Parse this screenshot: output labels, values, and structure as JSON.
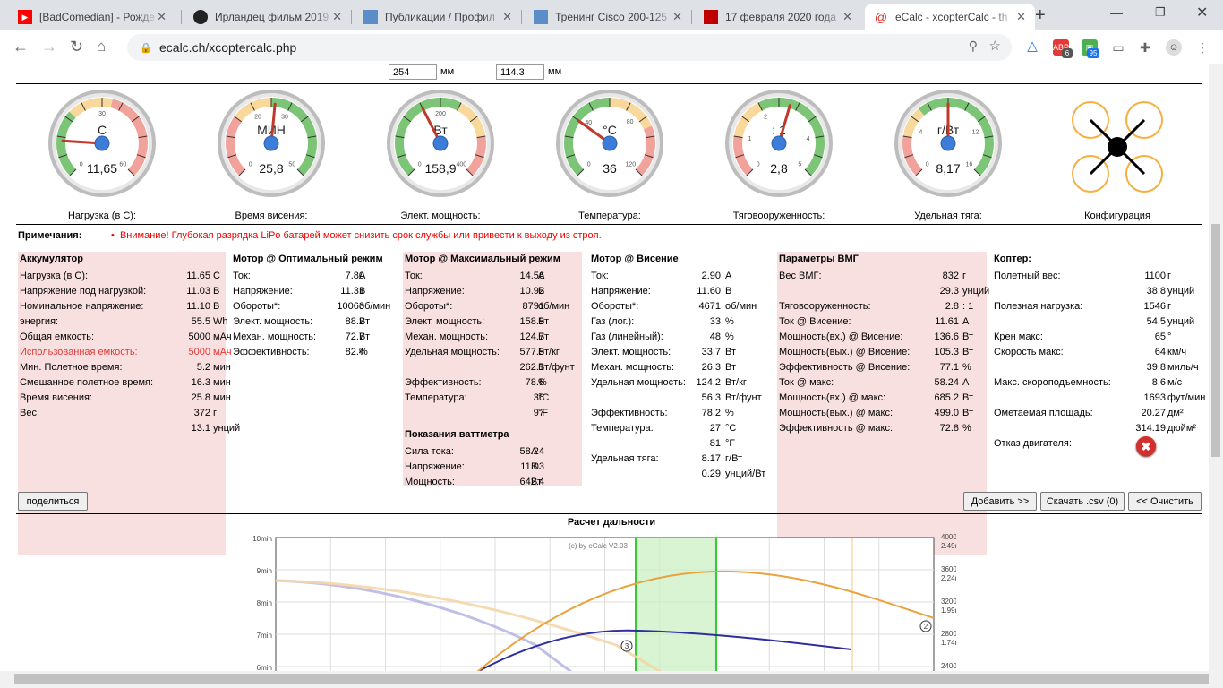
{
  "browser": {
    "tabs": [
      {
        "title": "[BadComedian] - Рожде",
        "icon": "youtube-icon",
        "color": "#ff0000"
      },
      {
        "title": "Ирландец фильм 2019",
        "icon": "avatar-icon",
        "color": "#222222"
      },
      {
        "title": "Публикации / Профил",
        "icon": "site-icon",
        "color": "#5b8ec9"
      },
      {
        "title": "Тренинг Cisco 200-125",
        "icon": "site-icon",
        "color": "#5b8ec9"
      },
      {
        "title": "17 февраля 2020 года",
        "icon": "news-icon",
        "color": "#c00000"
      },
      {
        "title": "eCalc - xcopterCalc - th",
        "icon": "ecalc-icon",
        "color": "#d0312d"
      }
    ],
    "url": "ecalc.ch/xcoptercalc.php",
    "ext_badges": [
      "6",
      "95"
    ]
  },
  "dims": {
    "v1": "254",
    "v2": "114.3",
    "unit": "мм"
  },
  "gauges": [
    {
      "unit": "C",
      "value": "11,65",
      "label": "Нагрузка (в С):",
      "ticks": [
        "0",
        "30",
        "60"
      ]
    },
    {
      "unit": "МИН",
      "value": "25,8",
      "label": "Время висения:",
      "ticks": [
        "0",
        "20",
        "30",
        "50"
      ]
    },
    {
      "unit": "Вт",
      "value": "158,9",
      "label": "Элект. мощность:",
      "ticks": [
        "0",
        "200",
        "400"
      ]
    },
    {
      "unit": "°C",
      "value": "36",
      "label": "Температура:",
      "ticks": [
        "0",
        "40",
        "80",
        "120"
      ]
    },
    {
      "unit": ": 1",
      "value": "2,8",
      "label": "Тяговооруженность:",
      "ticks": [
        "0",
        "1",
        "2",
        "4",
        "5"
      ]
    },
    {
      "unit": "г/Вт",
      "value": "8,17",
      "label": "Удельная тяга:",
      "ticks": [
        "0",
        "4",
        "12",
        "16"
      ]
    }
  ],
  "config_label": "Конфигурация",
  "notes": {
    "label": "Примечания:",
    "warning": "Внимание! Глубокая разрядка LiPo батарей может снизить срок службы или привести к выходу из строя."
  },
  "panels": {
    "battery": {
      "title": "Аккумулятор",
      "rows": [
        [
          "Нагрузка (в С):",
          "11.65",
          "C"
        ],
        [
          "Напряжение под нагрузкой:",
          "11.03",
          "В"
        ],
        [
          "Номинальное напряжение:",
          "11.10",
          "В"
        ],
        [
          "энергия:",
          "55.5",
          "Wh"
        ],
        [
          "Общая емкость:",
          "5000",
          "мАч"
        ],
        [
          "Использованная емкость:",
          "5000",
          "мАч"
        ],
        [
          "Мин. Полетное время:",
          "5.2",
          "мин"
        ],
        [
          "Смешанное полетное время:",
          "16.3",
          "мин"
        ],
        [
          "Время висения:",
          "25.8",
          "мин"
        ],
        [
          "Вес:",
          "372",
          "г"
        ],
        [
          "",
          "13.1",
          "унций"
        ]
      ]
    },
    "motor_opt": {
      "title": "Мотор @ Оптимальный режим",
      "rows": [
        [
          "Ток:",
          "7.80",
          "А"
        ],
        [
          "Напряжение:",
          "11.31",
          "В"
        ],
        [
          "Обороты*:",
          "10063",
          "об/мин"
        ],
        [
          "Элект. мощность:",
          "88.2",
          "Вт"
        ],
        [
          "Механ. мощность:",
          "72.7",
          "Вт"
        ],
        [
          "Эффективность:",
          "82.4",
          "%"
        ]
      ]
    },
    "motor_max": {
      "title": "Мотор @ Максимальный режим",
      "rows": [
        [
          "Ток:",
          "14.56",
          "А"
        ],
        [
          "Напряжение:",
          "10.92",
          "В"
        ],
        [
          "Обороты*:",
          "8791",
          "об/мин"
        ],
        [
          "Элект. мощность:",
          "158.9",
          "Вт"
        ],
        [
          "Механ. мощность:",
          "124.7",
          "Вт"
        ],
        [
          "Удельная мощность:",
          "577.9",
          "Вт/кг"
        ],
        [
          "",
          "262.1",
          "Вт/фунт"
        ],
        [
          "Эффективность:",
          "78.5",
          "%"
        ],
        [
          "Температура:",
          "36",
          "°C"
        ],
        [
          "",
          "97",
          "°F"
        ]
      ]
    },
    "wattmeter": {
      "title": "Показания ваттметра",
      "rows": [
        [
          "Сила тока:",
          "58.24",
          "А"
        ],
        [
          "Напряжение:",
          "11.03",
          "В"
        ],
        [
          "Мощность:",
          "642.4",
          "Вт"
        ]
      ]
    },
    "motor_hover": {
      "title": "Мотор @ Висение",
      "rows": [
        [
          "Ток:",
          "2.90",
          "А"
        ],
        [
          "Напряжение:",
          "11.60",
          "В"
        ],
        [
          "Обороты*:",
          "4671",
          "об/мин"
        ],
        [
          "Газ (лог.):",
          "33",
          "%"
        ],
        [
          "Газ (линейный):",
          "48",
          "%"
        ],
        [
          "Элект. мощность:",
          "33.7",
          "Вт"
        ],
        [
          "Механ. мощность:",
          "26.3",
          "Вт"
        ],
        [
          "Удельная мощность:",
          "124.2",
          "Вт/кг"
        ],
        [
          "",
          "56.3",
          "Вт/фунт"
        ],
        [
          "Эффективность:",
          "78.2",
          "%"
        ],
        [
          "Температура:",
          "27",
          "°C"
        ],
        [
          "",
          "81",
          "°F"
        ],
        [
          "Удельная тяга:",
          "8.17",
          "г/Вт"
        ],
        [
          "",
          "0.29",
          "унций/Вт"
        ]
      ]
    },
    "vmg": {
      "title": "Параметры ВМГ",
      "rows": [
        [
          "Вес ВМГ:",
          "832",
          "г"
        ],
        [
          "",
          "29.3",
          "унций"
        ],
        [
          "Тяговооруженность:",
          "2.8",
          ": 1"
        ],
        [
          "Ток @ Висение:",
          "11.61",
          "А"
        ],
        [
          "Мощность(вх.) @ Висение:",
          "136.6",
          "Вт"
        ],
        [
          "Мощность(вых.) @ Висение:",
          "105.3",
          "Вт"
        ],
        [
          "Эффективность @ Висение:",
          "77.1",
          "%"
        ],
        [
          "Ток @ макс:",
          "58.24",
          "А"
        ],
        [
          "Мощность(вх.) @ макс:",
          "685.2",
          "Вт"
        ],
        [
          "Мощность(вых.) @ макс:",
          "499.0",
          "Вт"
        ],
        [
          "Эффективность @ макс:",
          "72.8",
          "%"
        ]
      ]
    },
    "copter": {
      "title": "Коптер:",
      "rows": [
        [
          "Полетный вес:",
          "1100",
          "г"
        ],
        [
          "",
          "38.8",
          "унций"
        ],
        [
          "Полезная нагрузка:",
          "1546",
          "г"
        ],
        [
          "",
          "54.5",
          "унций"
        ],
        [
          "Крен макс:",
          "65",
          "°"
        ],
        [
          "Скорость макс:",
          "64",
          "км/ч"
        ],
        [
          "",
          "39.8",
          "миль/ч"
        ],
        [
          "Макс. скороподъемность:",
          "8.6",
          "м/с"
        ],
        [
          "",
          "1693",
          "фут/мин"
        ],
        [
          "Ометаемая площадь:",
          "20.27",
          "дм²"
        ],
        [
          "",
          "314.19",
          "дюйм²"
        ],
        [
          "Отказ двигателя:",
          "",
          ""
        ]
      ]
    }
  },
  "buttons": {
    "share": "поделиться",
    "add": "Добавить >>",
    "csv": "Скачать .csv (0)",
    "clear": "<< Очистить"
  },
  "chart_data": {
    "type": "line",
    "title": "Расчет дальности",
    "watermark": "(c) by eCalc  V2.03",
    "y_left_ticks": [
      "10min",
      "9min",
      "8min",
      "7min",
      "6min"
    ],
    "y_right_ticks": [
      [
        "4000m",
        "2.49mi"
      ],
      [
        "3600m",
        "2.24mi"
      ],
      [
        "3200m",
        "1.99mi"
      ],
      [
        "2800m",
        "1.74mi"
      ],
      [
        "2400m",
        ""
      ]
    ],
    "markers": [
      "2",
      "3"
    ],
    "colors": {
      "range": "#e8a33d",
      "flighttime": "#2e2e9e",
      "optimal": "#33cc33"
    }
  }
}
